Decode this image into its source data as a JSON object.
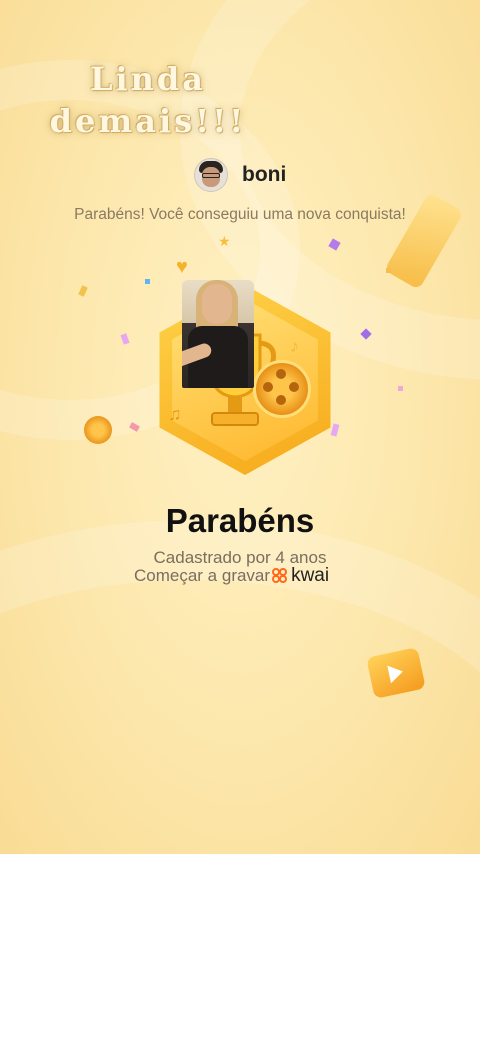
{
  "overlay_caption": "Linda\ndemais!!!",
  "user": {
    "name": "boni"
  },
  "achievement_message": "Parabéns! Você conseguiu uma nova conquista!",
  "title": "Parabéns",
  "registered_text": "Cadastrado por 4 anos",
  "start_recording_text": "Começar a gravar",
  "brand": {
    "name": "kwai",
    "icon": "kwai-logo-icon",
    "accent": "#ff6a1a"
  },
  "colors": {
    "background": "#fde9b0",
    "badge": "#f7a81a"
  }
}
